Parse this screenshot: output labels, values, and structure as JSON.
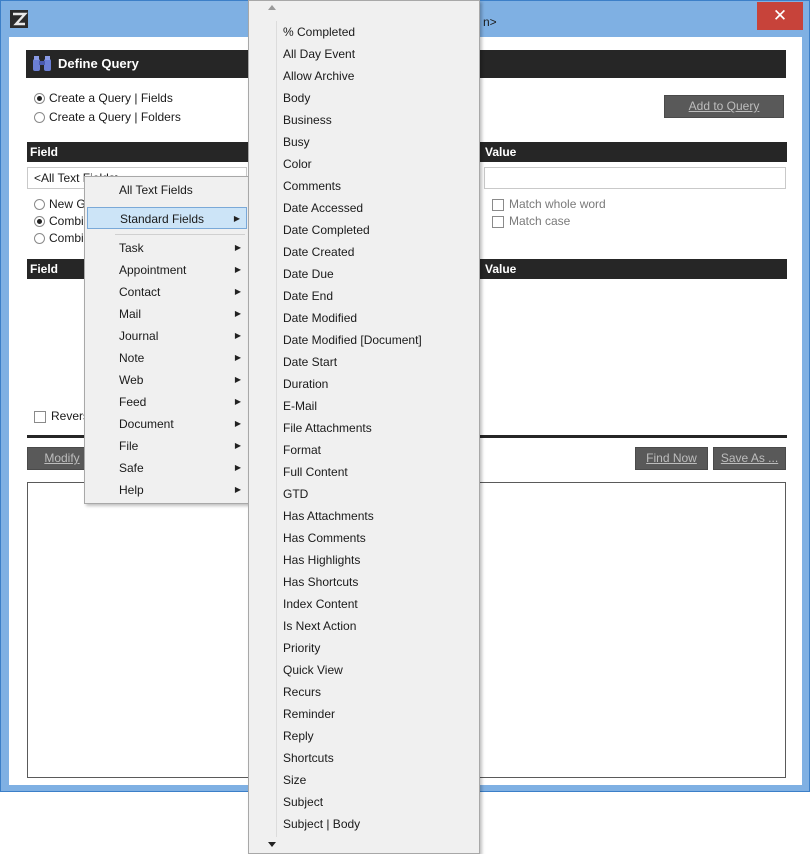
{
  "window": {
    "title_fragment": "n>",
    "close_glyph": "✕"
  },
  "panel": {
    "title": "Define Query",
    "query_mode": {
      "fields_label": "Create a Query | Fields",
      "folders_label": "Create a Query | Folders",
      "selected": "fields"
    },
    "add_to_query": "Add to Query",
    "field_header": "Field",
    "value_header": "Value",
    "field_value": "<All Text Fields>",
    "group_options": [
      "New Gr",
      "Combin",
      "Combin"
    ],
    "group_selected_index": 1,
    "match_whole_word": "Match whole word",
    "match_case": "Match case",
    "list_field_header": "Field",
    "list_value_header": "Value",
    "reverse_label": "Revers",
    "modify_button": "Modify",
    "find_now_button": "Find Now",
    "save_as_button": "Save As ..."
  },
  "context_menu": {
    "items": [
      {
        "label": "All Text Fields",
        "has_submenu": false
      },
      {
        "label": "Standard Fields",
        "has_submenu": true,
        "selected": true
      },
      {
        "label": "Task",
        "has_submenu": true
      },
      {
        "label": "Appointment",
        "has_submenu": true
      },
      {
        "label": "Contact",
        "has_submenu": true
      },
      {
        "label": "Mail",
        "has_submenu": true
      },
      {
        "label": "Journal",
        "has_submenu": true
      },
      {
        "label": "Note",
        "has_submenu": true
      },
      {
        "label": "Web",
        "has_submenu": true
      },
      {
        "label": "Feed",
        "has_submenu": true
      },
      {
        "label": "Document",
        "has_submenu": true
      },
      {
        "label": "File",
        "has_submenu": true
      },
      {
        "label": "Safe",
        "has_submenu": true
      },
      {
        "label": "Help",
        "has_submenu": true
      }
    ]
  },
  "submenu": {
    "items": [
      "% Completed",
      "All Day Event",
      "Allow Archive",
      "Body",
      "Business",
      "Busy",
      "Color",
      "Comments",
      "Date Accessed",
      "Date Completed",
      "Date Created",
      "Date Due",
      "Date End",
      "Date Modified",
      "Date Modified [Document]",
      "Date Start",
      "Duration",
      "E-Mail",
      "File Attachments",
      "Format",
      "Full Content",
      "GTD",
      "Has Attachments",
      "Has Comments",
      "Has Highlights",
      "Has Shortcuts",
      "Index Content",
      "Is Next Action",
      "Priority",
      "Quick View",
      "Recurs",
      "Reminder",
      "Reply",
      "Shortcuts",
      "Size",
      "Subject",
      "Subject | Body"
    ]
  },
  "colors": {
    "titlebar": "#7fb0e3",
    "header_bar": "#262626",
    "menu_bg": "#f0f0f0",
    "menu_selected": "#cce4f7",
    "close_button": "#c7433a"
  }
}
